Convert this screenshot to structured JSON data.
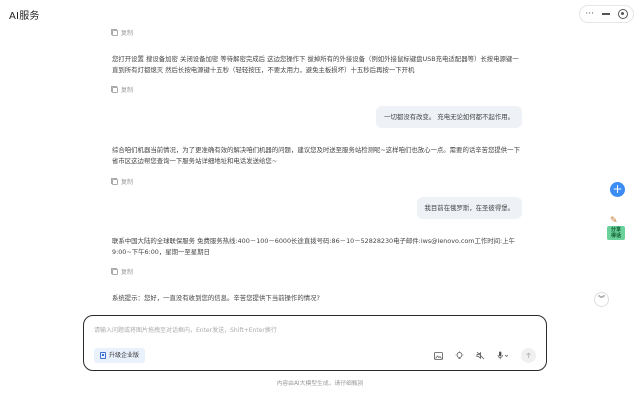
{
  "window": {
    "title": "AI服务",
    "controls": {
      "more": "···",
      "minimize": "",
      "close": ""
    }
  },
  "chat": {
    "copy_label": "复制",
    "messages": [
      {
        "role": "ai",
        "text": "您打开设置 搜设备加密 关闭设备加密 等待解密完成后 这边您操作下 拔掉所有的外接设备（例如外接鼠标键盘USB充电适配器等）长按电源键一直到所有灯都熄灭 然后长按电源键十五秒（轻轻按压，不要太用力，避免主板损坏）十五秒后再按一下开机"
      },
      {
        "role": "user",
        "text": "一切都没有改变。 充电无论如何都不起作用。"
      },
      {
        "role": "ai",
        "text": "综合咱们机器当前情况，为了更准确有效的解决咱们机器的问题，建议您及时送至服务站检测呢~这样咱们也放心一点。需要的话辛苦您提供一下省市区这边帮您查询一下服务站详细地址和电话发送给您~"
      },
      {
        "role": "user",
        "text": "我目前在俄罗斯，在圣彼得堡。"
      },
      {
        "role": "ai",
        "text": "联系中国大陆的全球联保服务 免费服务热线:400－100－6000长途直拨号码:86－10－52828230电子邮件:iws@lenovo.com工作时间:上午9:00~下午6:00，星期一至星期日"
      },
      {
        "role": "ai",
        "text": "系统提示：您好，一直没有收到您的信息。辛苦您提供下当前操作的情况?"
      }
    ]
  },
  "side": {
    "share_label": "分享\n得话",
    "plus": "+",
    "scroll_down": "︾"
  },
  "composer": {
    "placeholder": "请输入问题或将图片拖拽至对话框内，Enter发送，Shift+Enter换行",
    "upgrade_label": "升级企业版"
  },
  "footer": {
    "note": "内容由AI大模型生成，请仔细甄别"
  }
}
